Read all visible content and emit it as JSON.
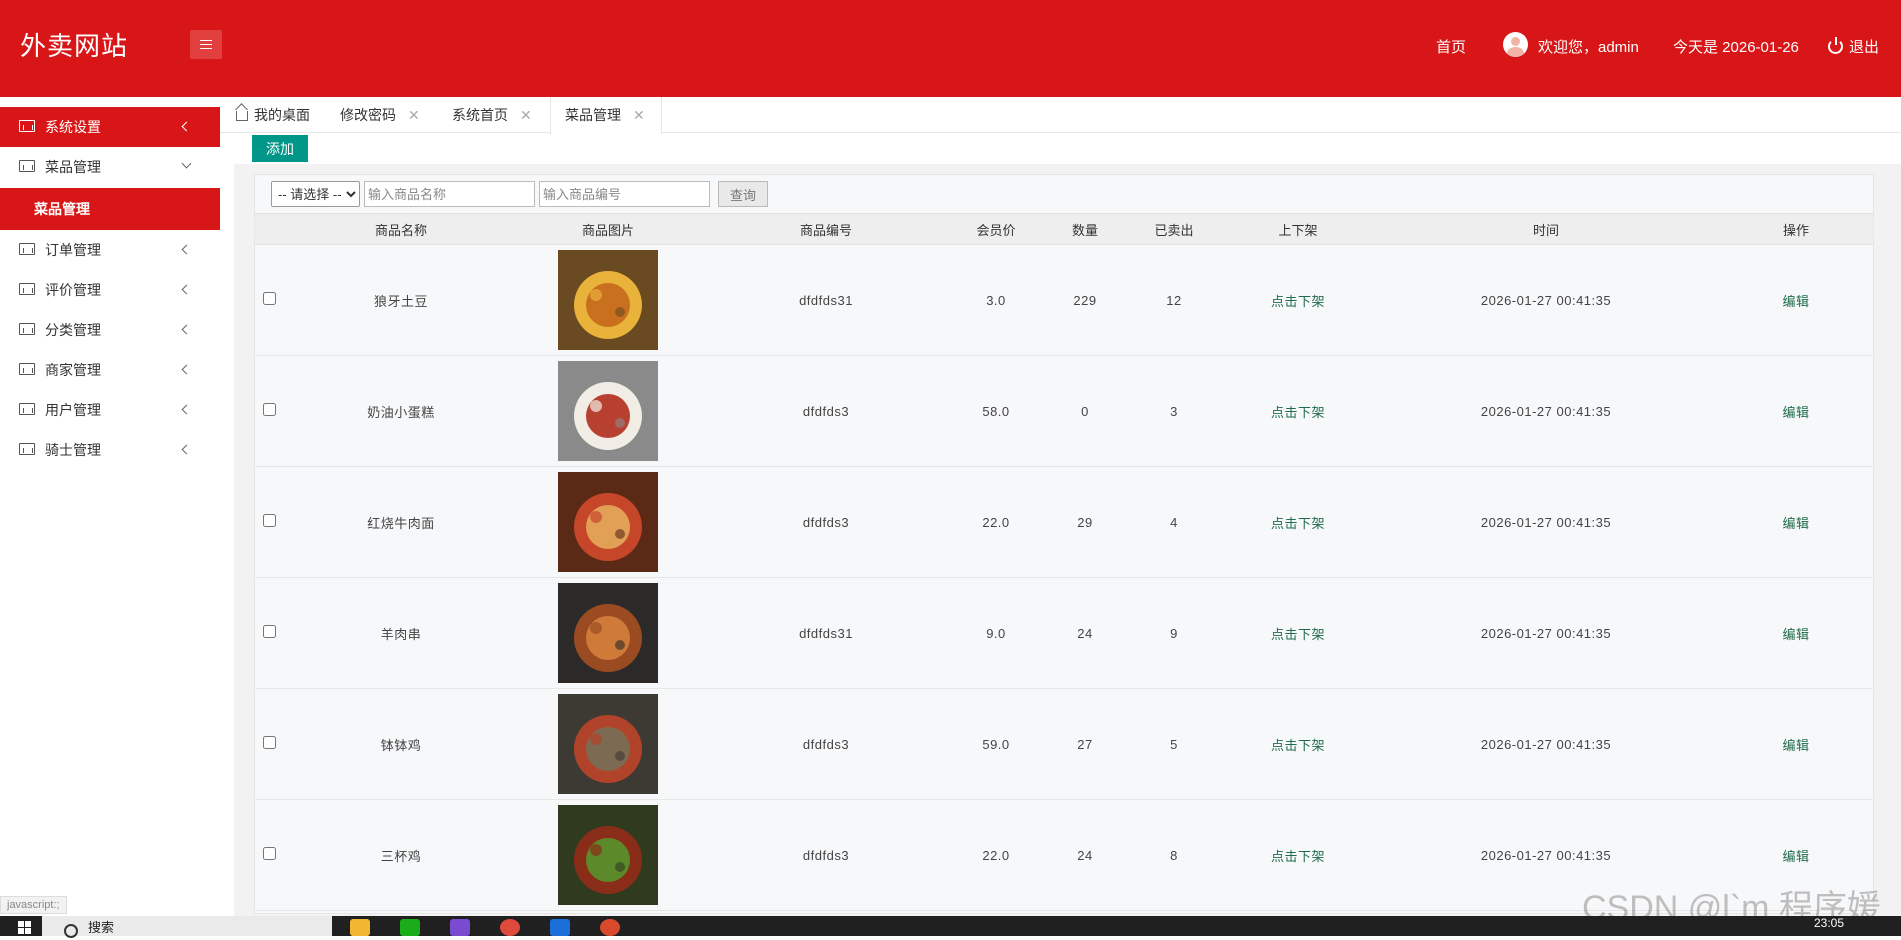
{
  "header": {
    "logo": "外卖网站",
    "home_link": "首页",
    "welcome": "欢迎您，admin",
    "date": "今天是 2026-01-26",
    "logout": "退出"
  },
  "sidebar": {
    "items": [
      {
        "label": "系统设置"
      },
      {
        "label": "菜品管理"
      },
      {
        "label": "菜品管理"
      },
      {
        "label": "订单管理"
      },
      {
        "label": "评价管理"
      },
      {
        "label": "分类管理"
      },
      {
        "label": "商家管理"
      },
      {
        "label": "用户管理"
      },
      {
        "label": "骑士管理"
      }
    ]
  },
  "tabs": [
    {
      "label": "我的桌面"
    },
    {
      "label": "修改密码"
    },
    {
      "label": "系统首页"
    },
    {
      "label": "菜品管理"
    }
  ],
  "toolbar": {
    "add_label": "添加"
  },
  "search": {
    "select_value": "-- 请选择 --",
    "name_placeholder": "输入商品名称",
    "code_placeholder": "输入商品编号",
    "query_label": "查询"
  },
  "table": {
    "columns": [
      "商品名称",
      "商品图片",
      "商品编号",
      "会员价",
      "数量",
      "已卖出",
      "上下架",
      "时间",
      "操作"
    ],
    "rows": [
      {
        "name": "狼牙土豆",
        "code": "dfdfds31",
        "price": "3.0",
        "qty": "229",
        "sold": "12",
        "toggle": "点击下架",
        "time": "2026-01-27 00:41:35",
        "action": "编辑"
      },
      {
        "name": "奶油小蛋糕",
        "code": "dfdfds3",
        "price": "58.0",
        "qty": "0",
        "sold": "3",
        "toggle": "点击下架",
        "time": "2026-01-27 00:41:35",
        "action": "编辑"
      },
      {
        "name": "红烧牛肉面",
        "code": "dfdfds3",
        "price": "22.0",
        "qty": "29",
        "sold": "4",
        "toggle": "点击下架",
        "time": "2026-01-27 00:41:35",
        "action": "编辑"
      },
      {
        "name": "羊肉串",
        "code": "dfdfds31",
        "price": "9.0",
        "qty": "24",
        "sold": "9",
        "toggle": "点击下架",
        "time": "2026-01-27 00:41:35",
        "action": "编辑"
      },
      {
        "name": "钵钵鸡",
        "code": "dfdfds3",
        "price": "59.0",
        "qty": "27",
        "sold": "5",
        "toggle": "点击下架",
        "time": "2026-01-27 00:41:35",
        "action": "编辑"
      },
      {
        "name": "三杯鸡",
        "code": "dfdfds3",
        "price": "22.0",
        "qty": "24",
        "sold": "8",
        "toggle": "点击下架",
        "time": "2026-01-27 00:41:35",
        "action": "编辑"
      }
    ]
  },
  "status_bar": "javascript:;",
  "taskbar": {
    "search_text": "搜索",
    "time": "23:05"
  },
  "watermark": "CSDN @l`m 程序媛",
  "colors": {
    "primary": "#d91617",
    "add_button": "#009688",
    "link": "#1f6b4a"
  }
}
